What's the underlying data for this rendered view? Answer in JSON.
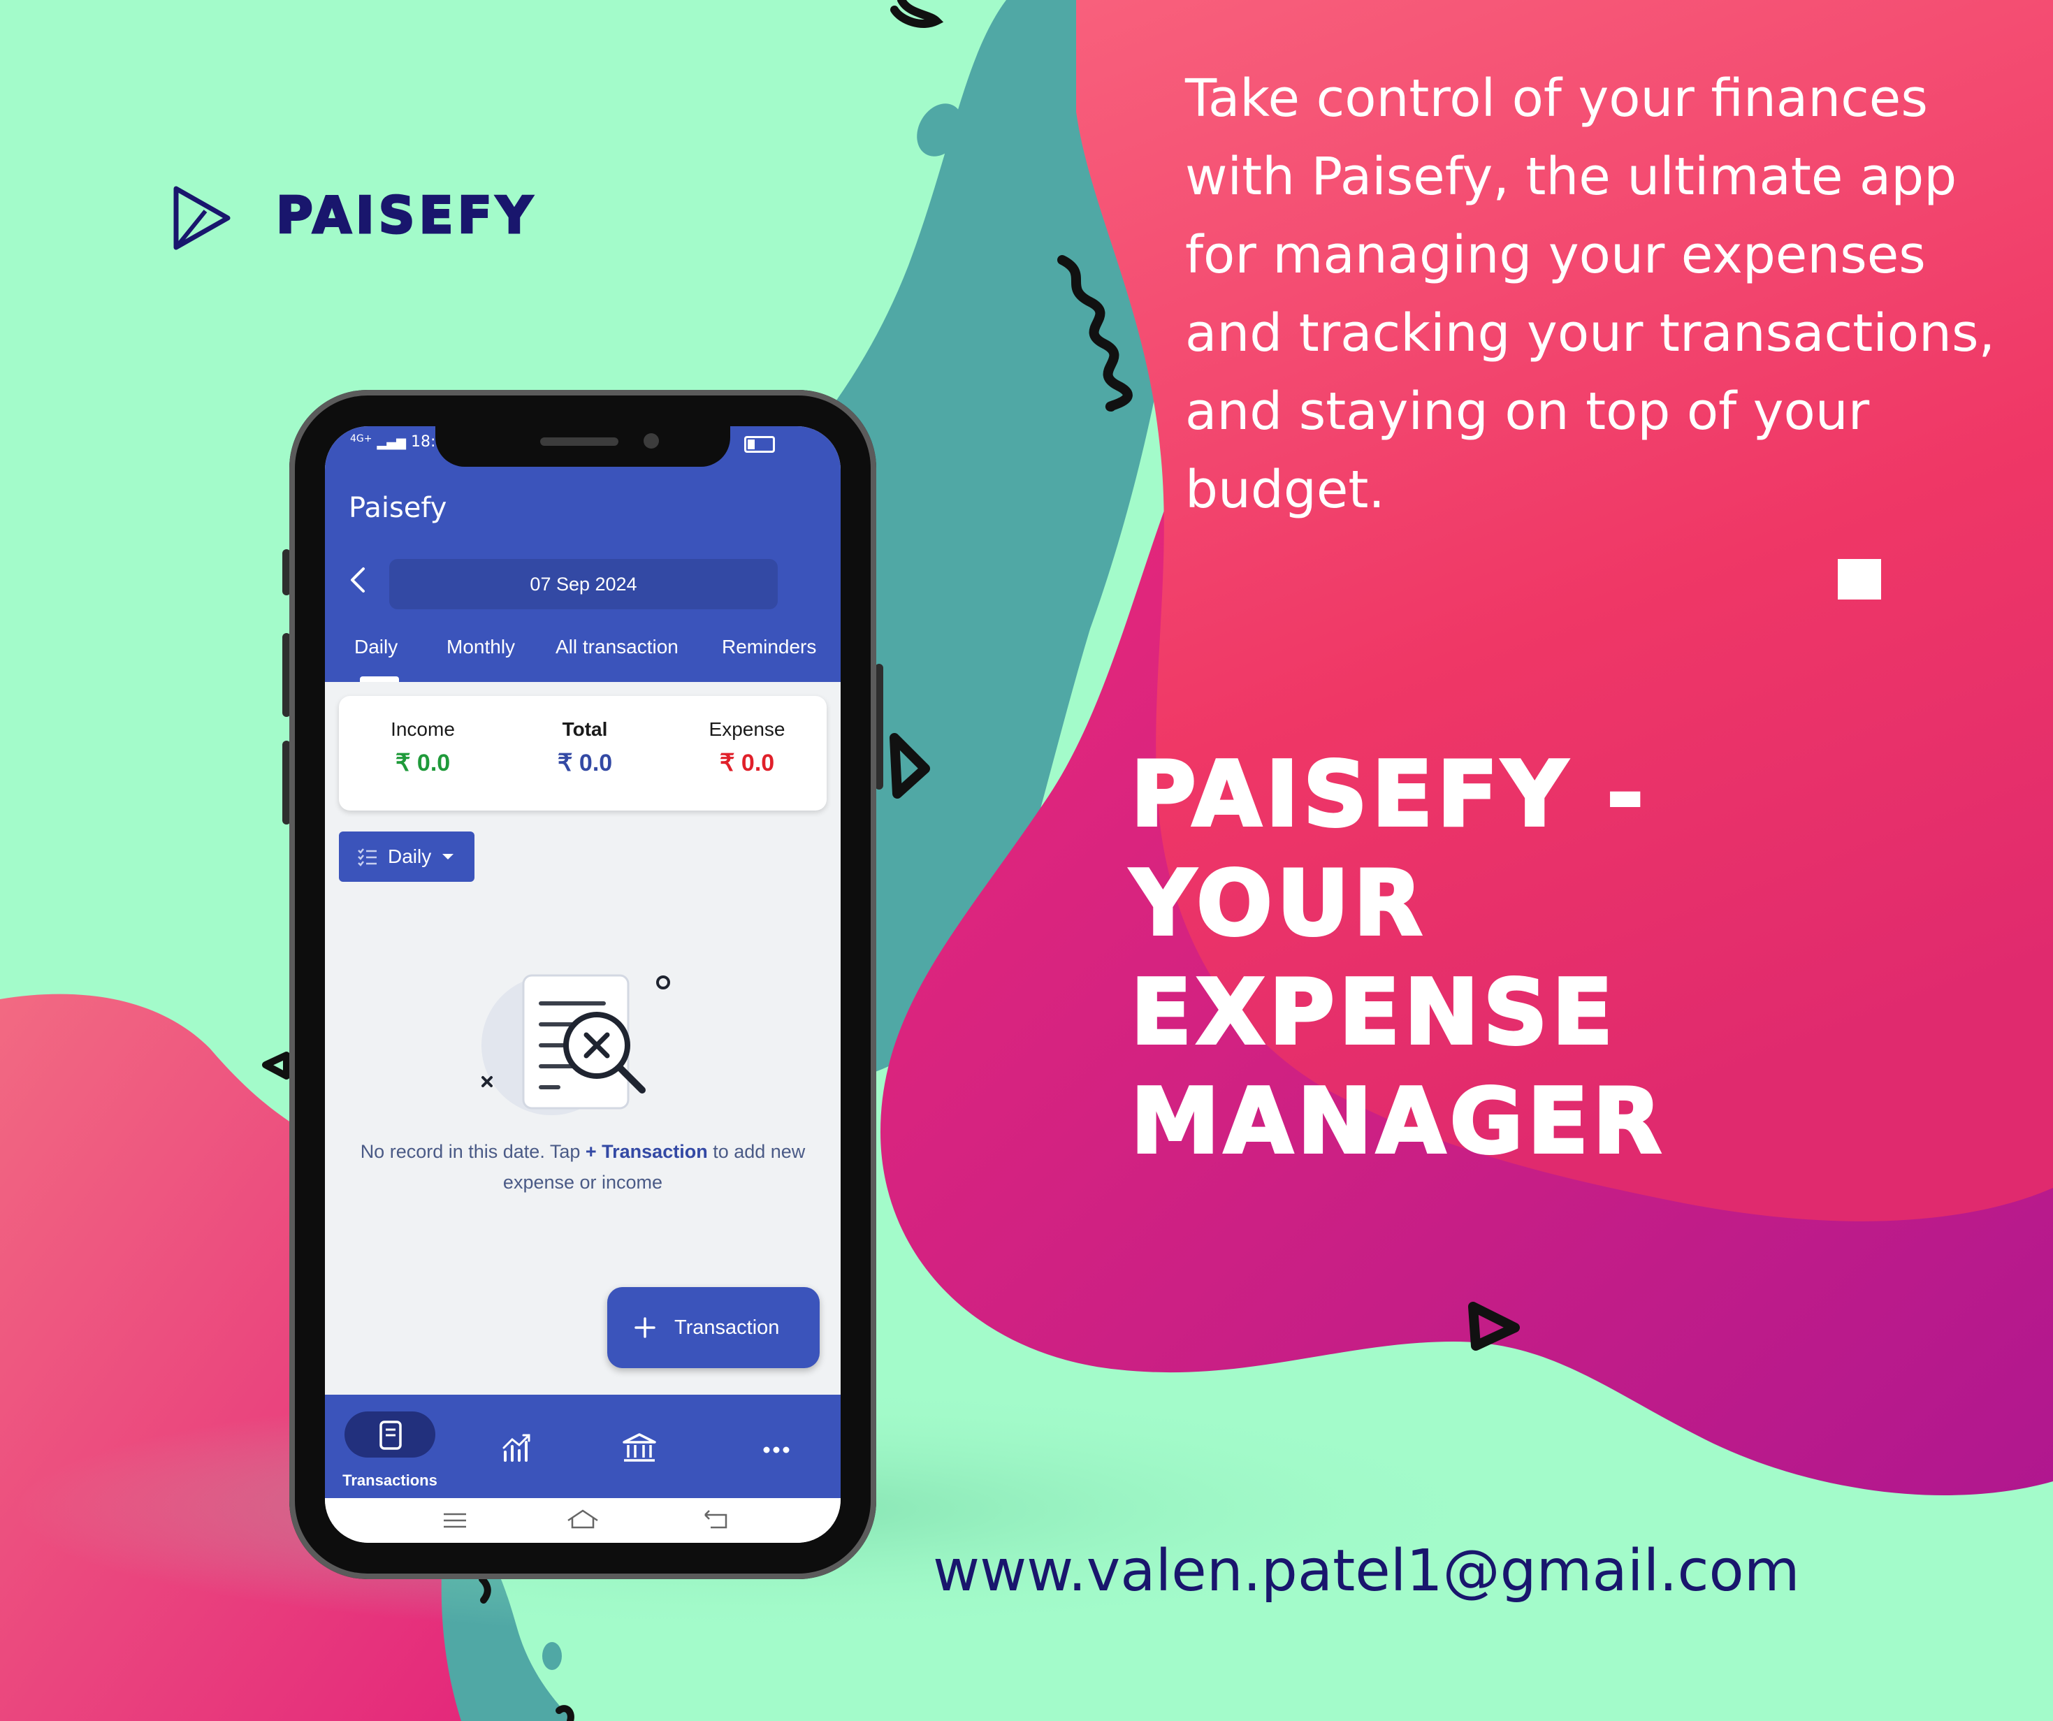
{
  "brand": {
    "name": "PAISEFY",
    "logo_icon": "play-triangle-icon"
  },
  "tagline": "Take control of your finances with Paisefy, the ultimate app for managing your expenses and tracking your transactions, and staying on top of your budget.",
  "headline": [
    "PAISEFY -",
    "YOUR",
    "EXPENSE",
    "MANAGER"
  ],
  "contact_email": "www.valen.patel1@gmail.com",
  "colors": {
    "mint_bg": "#a3fbca",
    "pink": "#ef3d6a",
    "magenta": "#d2148c",
    "teal": "#4aa3a3",
    "navy": "#19166d",
    "app_blue": "#3b54bb"
  },
  "app": {
    "status": {
      "network": "4G+",
      "time": "18:5"
    },
    "title": "Paisefy",
    "date": "07 Sep 2024",
    "tabs": [
      "Daily",
      "Monthly",
      "All transaction",
      "Reminders"
    ],
    "active_tab": "Daily",
    "summary": {
      "income_label": "Income",
      "income_value": "₹ 0.0",
      "total_label": "Total",
      "total_value": "₹ 0.0",
      "expense_label": "Expense",
      "expense_value": "₹ 0.0"
    },
    "filter": {
      "label": "Daily"
    },
    "empty": {
      "prefix": "No record in this date. Tap ",
      "link": "+ Transaction",
      "suffix": "  to add new expense or income"
    },
    "fab_label": "Transaction",
    "bottom_nav": [
      {
        "label": "Transactions",
        "icon": "book-icon"
      },
      {
        "icon": "stats-chart-icon"
      },
      {
        "icon": "bank-icon"
      },
      {
        "icon": "more-icon"
      }
    ]
  }
}
